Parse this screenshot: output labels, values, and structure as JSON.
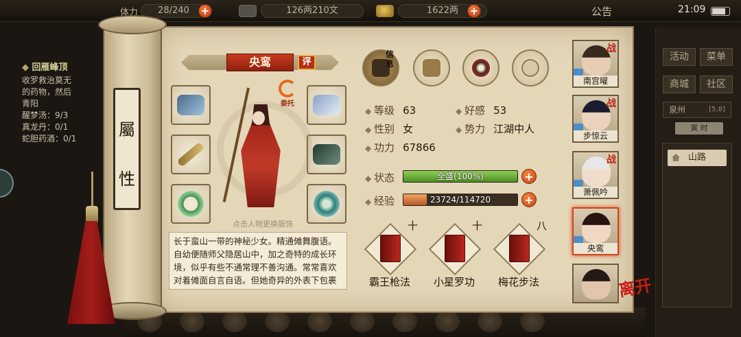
{
  "topbar": {
    "stamina_label": "体力",
    "stamina_value": "28/240",
    "silver_value": "126两210文",
    "gold_value": "1622两",
    "announce_label": "公告",
    "clock": "21:09"
  },
  "quest": {
    "title": "回雁峰顶",
    "lines": [
      "收罗救治莫无",
      "的药物，然后",
      "青阳"
    ],
    "items": [
      "醒梦汤：9/3",
      "真龙丹：0/1",
      "蛇胆药酒：0/1"
    ]
  },
  "scroll": {
    "tab_top": "屬",
    "tab_bottom": "性"
  },
  "character": {
    "name": "央鸾",
    "rate_badge": "评",
    "commission_label": "委托",
    "hint": "点击人物更换服饰",
    "bio": "长于蛮山一带的神秘少女。精通傩舞腹语。自幼便随师父隐居山中，加之奇特的成长环境，似乎有些不通常理不善沟通。常常喜欢对着傩面自言自语。但她奇异的外表下包裹着一颗赤诚纯善的心"
  },
  "tabs": {
    "info_label": "信息"
  },
  "stats": {
    "level_label": "等级",
    "level": "63",
    "favor_label": "好感",
    "favor": "53",
    "gender_label": "性别",
    "gender": "女",
    "faction_label": "势力",
    "faction": "江湖中人",
    "power_label": "功力",
    "power": "67866"
  },
  "status": {
    "label": "状态",
    "text": "全盛(100%)",
    "fill": 1.0
  },
  "exp": {
    "label": "经验",
    "text": "23724/114720",
    "fill": 0.207
  },
  "skills": [
    {
      "name": "霸王枪法",
      "mark": "十"
    },
    {
      "name": "小星罗功",
      "mark": "十"
    },
    {
      "name": "梅花步法",
      "mark": "八"
    }
  ],
  "roster": [
    {
      "name": "南宫曜",
      "war": "战"
    },
    {
      "name": "步惊云",
      "war": "战"
    },
    {
      "name": "萧佩吟",
      "war": "战"
    },
    {
      "name": "央鸾",
      "war": ""
    },
    {
      "name": "",
      "war": ""
    }
  ],
  "leave_label": "离开",
  "right_panel": {
    "buttons": [
      "活动",
      "菜单",
      "商城",
      "社区"
    ],
    "region": "泉州",
    "coord": "[5,8]",
    "region_tag": "寅 时",
    "map_item": "山路"
  },
  "colors": {
    "parchment": "#e4d7b8",
    "accent_red": "#b23016",
    "hp_green": "#4e8f26",
    "exp_orange": "#b4582a"
  }
}
